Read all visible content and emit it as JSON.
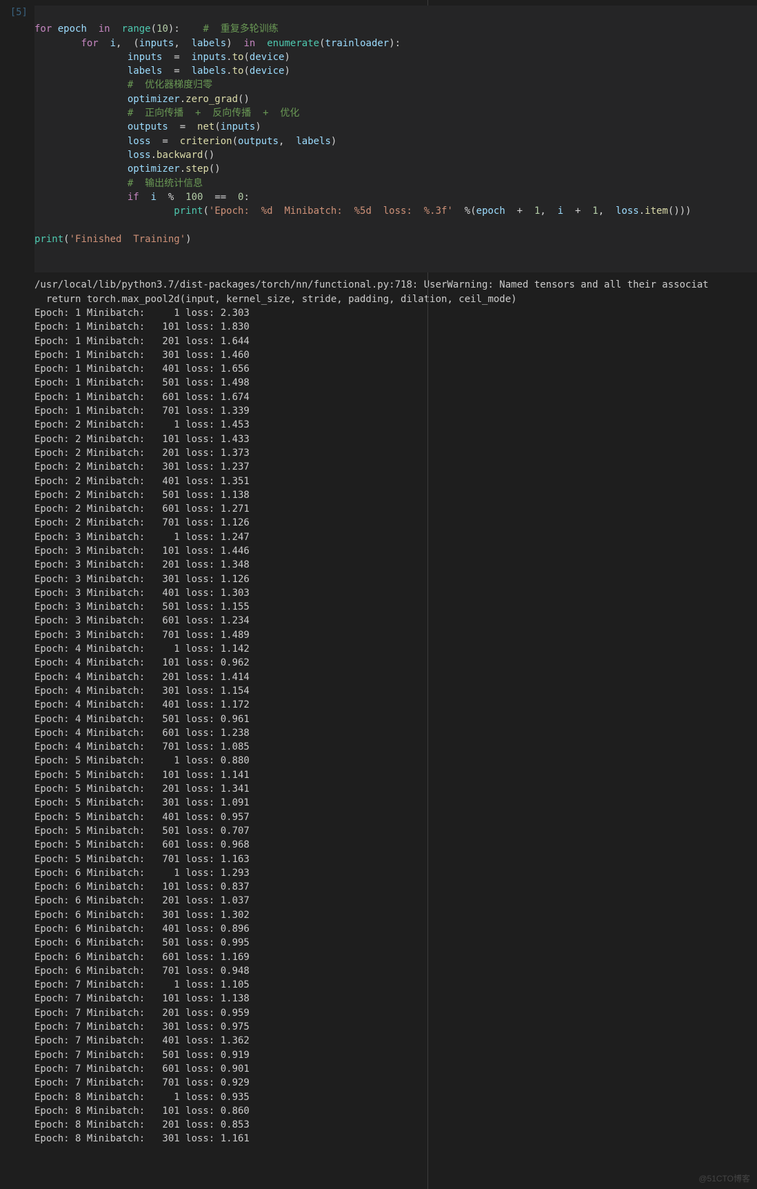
{
  "cell": {
    "prompt": "[5]"
  },
  "watermark": "@51CTO博客",
  "code": {
    "l1": {
      "for": "for",
      "epoch": "epoch",
      "in": "in",
      "range": "range",
      "ten": "10",
      "cm": "#  重复多轮训练"
    },
    "l2": {
      "for": "for",
      "i": "i",
      "inputs": "inputs",
      "labels": "labels",
      "in": "in",
      "enum": "enumerate",
      "trainloader": "trainloader"
    },
    "l3": {
      "inputs": "inputs",
      "inputs2": "inputs",
      "to": "to",
      "device": "device"
    },
    "l4": {
      "labels": "labels",
      "labels2": "labels",
      "to": "to",
      "device": "device"
    },
    "l5": {
      "cm": "#  优化器梯度归零"
    },
    "l6": {
      "optimizer": "optimizer",
      "zero": "zero_grad"
    },
    "l7": {
      "cm": "#  正向传播  +  反向传播  +  优化"
    },
    "l8": {
      "outputs": "outputs",
      "net": "net",
      "inputs": "inputs"
    },
    "l9": {
      "loss": "loss",
      "criterion": "criterion",
      "outputs": "outputs",
      "labels": "labels"
    },
    "l10": {
      "loss": "loss",
      "backward": "backward"
    },
    "l11": {
      "optimizer": "optimizer",
      "step": "step"
    },
    "l12": {
      "cm": "#  输出统计信息"
    },
    "l13": {
      "if": "if",
      "i": "i",
      "mod": "%",
      "hundred": "100",
      "eq": "==",
      "zero": "0"
    },
    "l14": {
      "print": "print",
      "fmt": "'Epoch:  %d  Minibatch:  %5d  loss:  %.3f'",
      "pct": "%",
      "epoch": "epoch",
      "plus1": "+",
      "one1": "1",
      "i": "i",
      "plus2": "+",
      "one2": "1",
      "loss": "loss",
      "item": "item"
    },
    "l16": {
      "print": "print",
      "str": "'Finished  Training'"
    }
  },
  "output": {
    "warning1": "/usr/local/lib/python3.7/dist-packages/torch/nn/functional.py:718: UserWarning: Named tensors and all their associat",
    "warning2": "  return torch.max_pool2d(input, kernel_size, stride, padding, dilation, ceil_mode)",
    "lines": [
      {
        "epoch": 1,
        "mb": 1,
        "loss": "2.303"
      },
      {
        "epoch": 1,
        "mb": 101,
        "loss": "1.830"
      },
      {
        "epoch": 1,
        "mb": 201,
        "loss": "1.644"
      },
      {
        "epoch": 1,
        "mb": 301,
        "loss": "1.460"
      },
      {
        "epoch": 1,
        "mb": 401,
        "loss": "1.656"
      },
      {
        "epoch": 1,
        "mb": 501,
        "loss": "1.498"
      },
      {
        "epoch": 1,
        "mb": 601,
        "loss": "1.674"
      },
      {
        "epoch": 1,
        "mb": 701,
        "loss": "1.339"
      },
      {
        "epoch": 2,
        "mb": 1,
        "loss": "1.453"
      },
      {
        "epoch": 2,
        "mb": 101,
        "loss": "1.433"
      },
      {
        "epoch": 2,
        "mb": 201,
        "loss": "1.373"
      },
      {
        "epoch": 2,
        "mb": 301,
        "loss": "1.237"
      },
      {
        "epoch": 2,
        "mb": 401,
        "loss": "1.351"
      },
      {
        "epoch": 2,
        "mb": 501,
        "loss": "1.138"
      },
      {
        "epoch": 2,
        "mb": 601,
        "loss": "1.271"
      },
      {
        "epoch": 2,
        "mb": 701,
        "loss": "1.126"
      },
      {
        "epoch": 3,
        "mb": 1,
        "loss": "1.247"
      },
      {
        "epoch": 3,
        "mb": 101,
        "loss": "1.446"
      },
      {
        "epoch": 3,
        "mb": 201,
        "loss": "1.348"
      },
      {
        "epoch": 3,
        "mb": 301,
        "loss": "1.126"
      },
      {
        "epoch": 3,
        "mb": 401,
        "loss": "1.303"
      },
      {
        "epoch": 3,
        "mb": 501,
        "loss": "1.155"
      },
      {
        "epoch": 3,
        "mb": 601,
        "loss": "1.234"
      },
      {
        "epoch": 3,
        "mb": 701,
        "loss": "1.489"
      },
      {
        "epoch": 4,
        "mb": 1,
        "loss": "1.142"
      },
      {
        "epoch": 4,
        "mb": 101,
        "loss": "0.962"
      },
      {
        "epoch": 4,
        "mb": 201,
        "loss": "1.414"
      },
      {
        "epoch": 4,
        "mb": 301,
        "loss": "1.154"
      },
      {
        "epoch": 4,
        "mb": 401,
        "loss": "1.172"
      },
      {
        "epoch": 4,
        "mb": 501,
        "loss": "0.961"
      },
      {
        "epoch": 4,
        "mb": 601,
        "loss": "1.238"
      },
      {
        "epoch": 4,
        "mb": 701,
        "loss": "1.085"
      },
      {
        "epoch": 5,
        "mb": 1,
        "loss": "0.880"
      },
      {
        "epoch": 5,
        "mb": 101,
        "loss": "1.141"
      },
      {
        "epoch": 5,
        "mb": 201,
        "loss": "1.341"
      },
      {
        "epoch": 5,
        "mb": 301,
        "loss": "1.091"
      },
      {
        "epoch": 5,
        "mb": 401,
        "loss": "0.957"
      },
      {
        "epoch": 5,
        "mb": 501,
        "loss": "0.707"
      },
      {
        "epoch": 5,
        "mb": 601,
        "loss": "0.968"
      },
      {
        "epoch": 5,
        "mb": 701,
        "loss": "1.163"
      },
      {
        "epoch": 6,
        "mb": 1,
        "loss": "1.293"
      },
      {
        "epoch": 6,
        "mb": 101,
        "loss": "0.837"
      },
      {
        "epoch": 6,
        "mb": 201,
        "loss": "1.037"
      },
      {
        "epoch": 6,
        "mb": 301,
        "loss": "1.302"
      },
      {
        "epoch": 6,
        "mb": 401,
        "loss": "0.896"
      },
      {
        "epoch": 6,
        "mb": 501,
        "loss": "0.995"
      },
      {
        "epoch": 6,
        "mb": 601,
        "loss": "1.169"
      },
      {
        "epoch": 6,
        "mb": 701,
        "loss": "0.948"
      },
      {
        "epoch": 7,
        "mb": 1,
        "loss": "1.105"
      },
      {
        "epoch": 7,
        "mb": 101,
        "loss": "1.138"
      },
      {
        "epoch": 7,
        "mb": 201,
        "loss": "0.959"
      },
      {
        "epoch": 7,
        "mb": 301,
        "loss": "0.975"
      },
      {
        "epoch": 7,
        "mb": 401,
        "loss": "1.362"
      },
      {
        "epoch": 7,
        "mb": 501,
        "loss": "0.919"
      },
      {
        "epoch": 7,
        "mb": 601,
        "loss": "0.901"
      },
      {
        "epoch": 7,
        "mb": 701,
        "loss": "0.929"
      },
      {
        "epoch": 8,
        "mb": 1,
        "loss": "0.935"
      },
      {
        "epoch": 8,
        "mb": 101,
        "loss": "0.860"
      },
      {
        "epoch": 8,
        "mb": 201,
        "loss": "0.853"
      },
      {
        "epoch": 8,
        "mb": 301,
        "loss": "1.161"
      }
    ]
  }
}
